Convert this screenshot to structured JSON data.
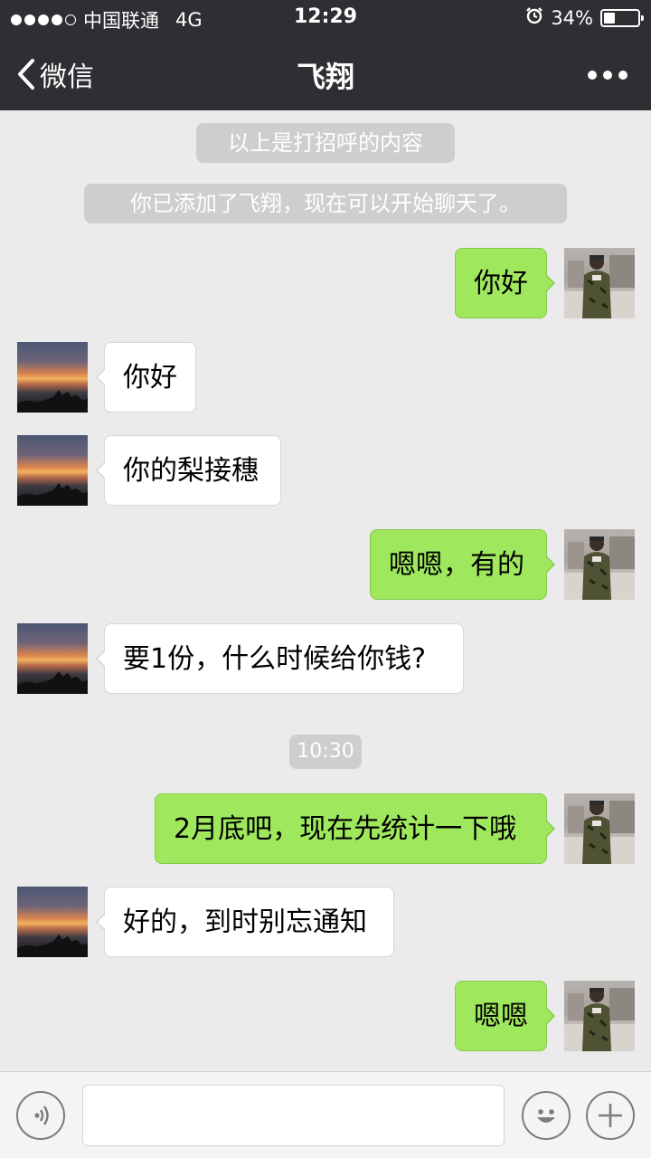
{
  "status_bar": {
    "carrier": "中国联通",
    "network": "4G",
    "time": "12:29",
    "battery_percent": "34%",
    "battery_level": 0.34
  },
  "nav": {
    "back_label": "微信",
    "title": "飞翔"
  },
  "system_messages": {
    "greeting_note": "以上是打招呼的内容",
    "added_note": "你已添加了飞翔，现在可以开始聊天了。",
    "timestamp": "10:30"
  },
  "messages": [
    {
      "from": "me",
      "text": "你好"
    },
    {
      "from": "friend",
      "text": "你好"
    },
    {
      "from": "friend",
      "text": "你的梨接穗"
    },
    {
      "from": "me",
      "text": "嗯嗯，有的"
    },
    {
      "from": "friend",
      "text": "要1份，什么时候给你钱?"
    },
    {
      "from": "me",
      "text": "2月底吧，现在先统计一下哦"
    },
    {
      "from": "friend",
      "text": "好的，到时别忘通知"
    },
    {
      "from": "me",
      "text": "嗯嗯"
    }
  ],
  "colors": {
    "header_bg": "#2e2e33",
    "chat_bg": "#ebebeb",
    "outgoing_bubble": "#9fe85e",
    "incoming_bubble": "#ffffff",
    "system_pill": "#cecece"
  },
  "input_bar": {
    "icons": [
      "voice-icon",
      "emoji-icon",
      "plus-icon"
    ],
    "text_value": ""
  }
}
